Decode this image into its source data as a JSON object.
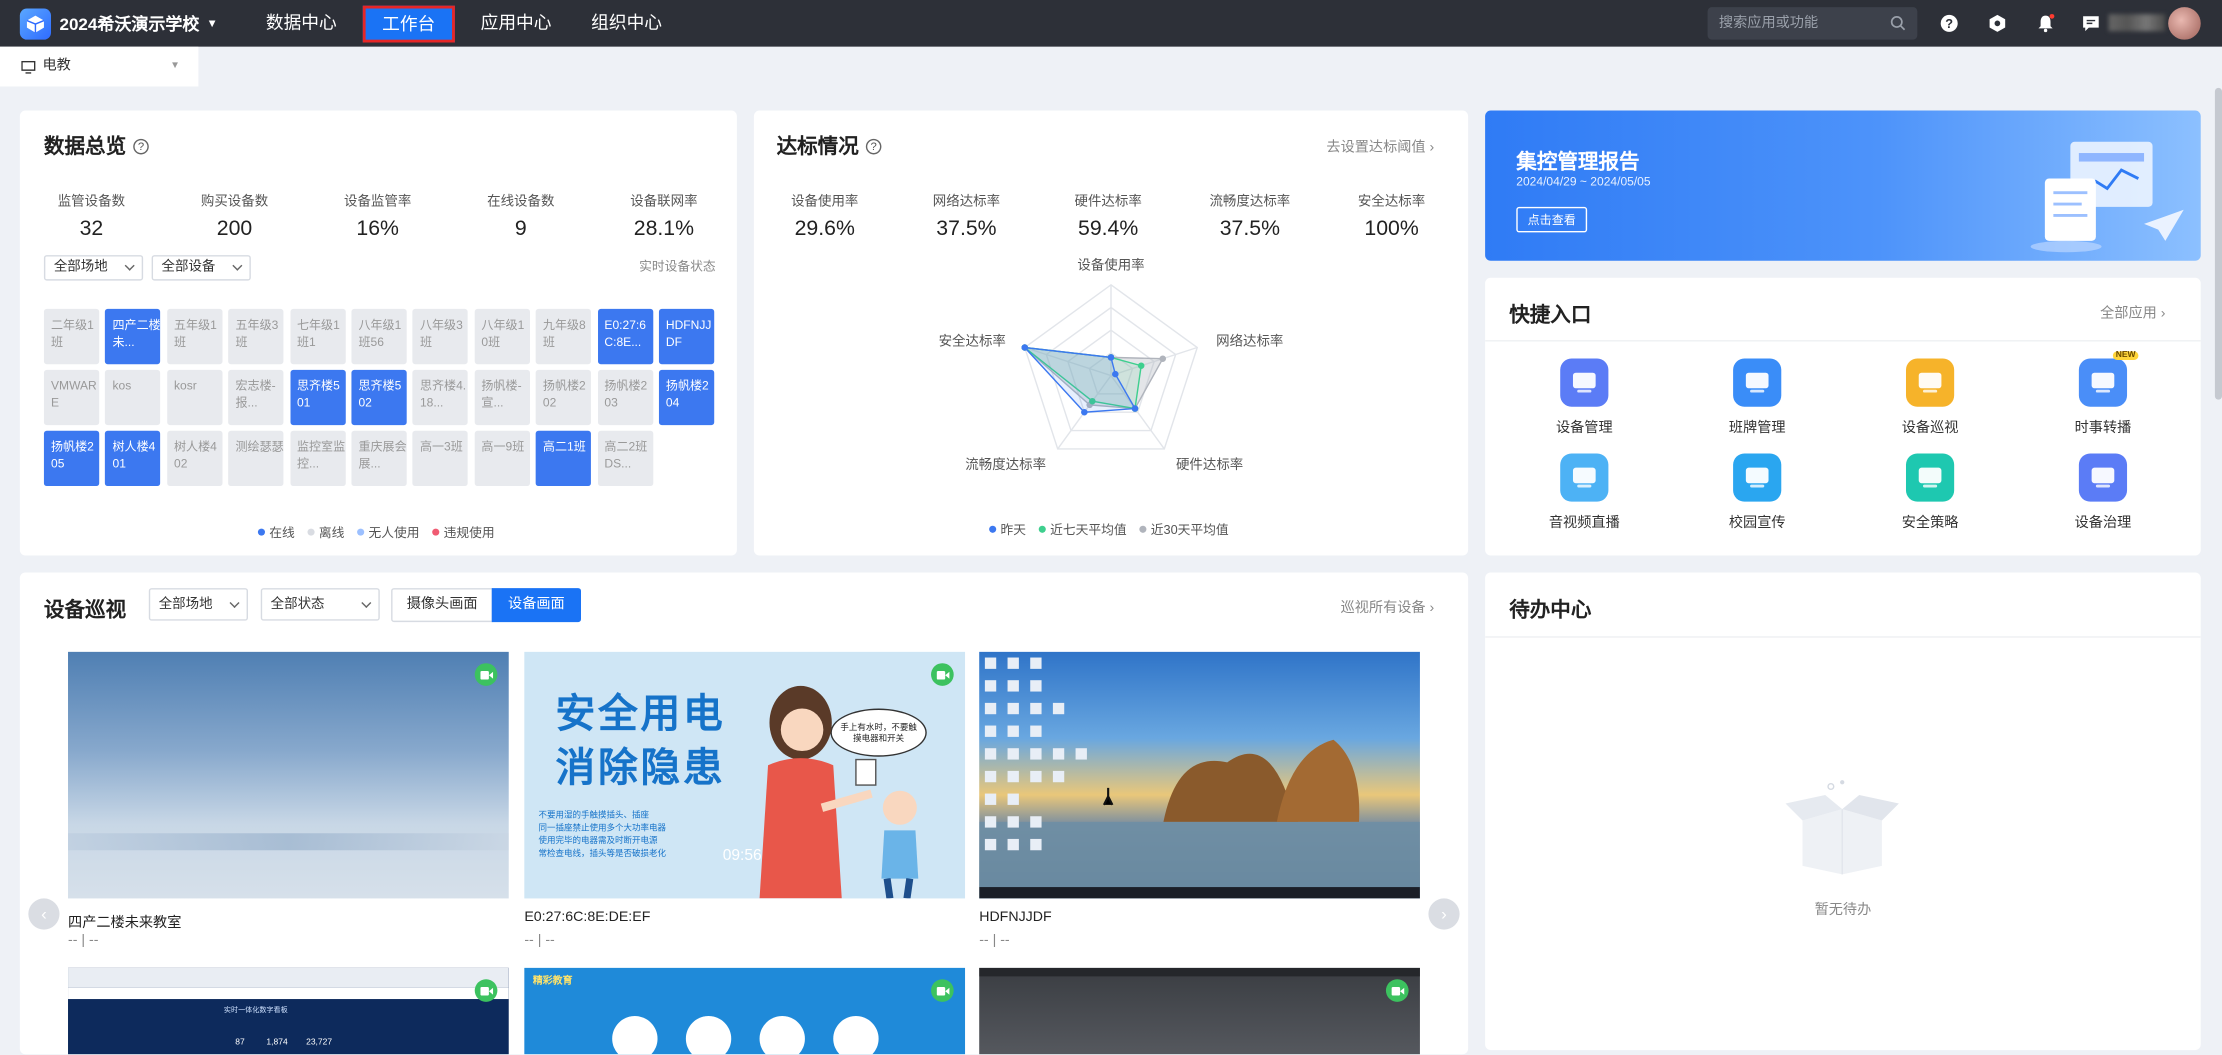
{
  "header": {
    "school": "2024希沃演示学校",
    "nav": [
      "数据中心",
      "工作台",
      "应用中心",
      "组织中心"
    ],
    "active_nav": "工作台",
    "search_placeholder": "搜索应用或功能"
  },
  "subtab": {
    "label": "电教"
  },
  "overview": {
    "title": "数据总览",
    "stats": [
      {
        "label": "监管设备数",
        "value": "32"
      },
      {
        "label": "购买设备数",
        "value": "200"
      },
      {
        "label": "设备监管率",
        "value": "16%"
      },
      {
        "label": "在线设备数",
        "value": "9"
      },
      {
        "label": "设备联网率",
        "value": "28.1%"
      }
    ],
    "filter_site": "全部场地",
    "filter_device": "全部设备",
    "realtime_link": "实时设备状态",
    "cells": [
      {
        "t": "二年级1班",
        "on": false
      },
      {
        "t": "四产二楼未...",
        "on": true
      },
      {
        "t": "五年级1班",
        "on": false
      },
      {
        "t": "五年级3班",
        "on": false
      },
      {
        "t": "七年级1班1",
        "on": false
      },
      {
        "t": "八年级1班56",
        "on": false
      },
      {
        "t": "八年级3班",
        "on": false
      },
      {
        "t": "八年级10班",
        "on": false
      },
      {
        "t": "九年级8班",
        "on": false
      },
      {
        "t": "E0:27:6C:8E...",
        "on": true
      },
      {
        "t": "HDFNJJDF",
        "on": true
      },
      {
        "t": "VMWARE",
        "on": false
      },
      {
        "t": "kos",
        "on": false
      },
      {
        "t": "kosr",
        "on": false
      },
      {
        "t": "宏志楼-报...",
        "on": false
      },
      {
        "t": "思齐楼501",
        "on": true
      },
      {
        "t": "思齐楼502",
        "on": true
      },
      {
        "t": "思齐楼4.18...",
        "on": false
      },
      {
        "t": "扬帆楼-宣...",
        "on": false
      },
      {
        "t": "扬帆楼202",
        "on": false
      },
      {
        "t": "扬帆楼203",
        "on": false
      },
      {
        "t": "扬帆楼204",
        "on": true
      },
      {
        "t": "扬帆楼205",
        "on": true
      },
      {
        "t": "树人楼401",
        "on": true
      },
      {
        "t": "树人楼402",
        "on": false
      },
      {
        "t": "测绘瑟瑟",
        "on": false
      },
      {
        "t": "监控室监控...",
        "on": false
      },
      {
        "t": "重庆展会展...",
        "on": false
      },
      {
        "t": "高一3班",
        "on": false
      },
      {
        "t": "高一9班",
        "on": false
      },
      {
        "t": "高二1班",
        "on": true
      },
      {
        "t": "高二2班DS...",
        "on": false
      }
    ],
    "legend": [
      {
        "label": "在线",
        "color": "#3c78f0"
      },
      {
        "label": "离线",
        "color": "#d9dce2"
      },
      {
        "label": "无人使用",
        "color": "#9cc0ff"
      },
      {
        "label": "违规使用",
        "color": "#f05b72"
      }
    ]
  },
  "compliance": {
    "title": "达标情况",
    "link": "去设置达标阈值",
    "stats": [
      {
        "label": "设备使用率",
        "value": "29.6%"
      },
      {
        "label": "网络达标率",
        "value": "37.5%"
      },
      {
        "label": "硬件达标率",
        "value": "59.4%"
      },
      {
        "label": "流畅度达标率",
        "value": "37.5%"
      },
      {
        "label": "安全达标率",
        "value": "100%"
      }
    ],
    "radar_axes": [
      "设备使用率",
      "网络达标率",
      "硬件达标率",
      "流畅度达标率",
      "安全达标率"
    ],
    "series": [
      {
        "name": "昨天",
        "color": "#3c78f0",
        "values": [
          0.2,
          0.05,
          0.45,
          0.5,
          1.0
        ]
      },
      {
        "name": "近七天平均值",
        "color": "#3ecf8e",
        "values": [
          0.2,
          0.35,
          0.45,
          0.35,
          1.0
        ]
      },
      {
        "name": "近30天平均值",
        "color": "#b0b4bc",
        "values": [
          0.2,
          0.6,
          0.45,
          0.4,
          1.0
        ]
      }
    ]
  },
  "report": {
    "title": "集控管理报告",
    "date": "2024/04/29 ~ 2024/05/05",
    "button": "点击查看"
  },
  "quick": {
    "title": "快捷入口",
    "link": "全部应用",
    "new_badge": "NEW",
    "items": [
      {
        "label": "设备管理",
        "color": "#5b7cf6"
      },
      {
        "label": "班牌管理",
        "color": "#3a8df8"
      },
      {
        "label": "设备巡视",
        "color": "#f6b32a"
      },
      {
        "label": "时事转播",
        "color": "#4a8ef8"
      },
      {
        "label": "音视频直播",
        "color": "#4db2f5"
      },
      {
        "label": "校园宣传",
        "color": "#2aa6f0"
      },
      {
        "label": "安全策略",
        "color": "#1ec8b0"
      },
      {
        "label": "设备治理",
        "color": "#5b7cf6"
      }
    ]
  },
  "patrol": {
    "title": "设备巡视",
    "filter_site": "全部场地",
    "filter_status": "全部状态",
    "seg_camera": "摄像头画面",
    "seg_device": "设备画面",
    "link": "巡视所有设备",
    "tiles": [
      {
        "name": "四产二楼未来教室",
        "sub": "-- | --"
      },
      {
        "name": "E0:27:6C:8E:DE:EF",
        "sub": "-- | --",
        "poster_title_1": "安全用电",
        "poster_title_2": "消除隐患",
        "bubble": "手上有水时，不要触摸电器和开关",
        "time": "09:56",
        "tips": [
          "不要用湿的手触摸插头、插座",
          "同一插座禁止使用多个大功率电器",
          "使用完毕的电器需及时断开电源",
          "常检查电线，插头等是否破损老化"
        ]
      },
      {
        "name": "HDFNJJDF",
        "sub": "-- | --"
      }
    ],
    "bottom_tiles": [
      {
        "banner": "实时一体化数字看板",
        "stats": [
          "87",
          "1,874",
          "23,727"
        ]
      },
      {
        "brand": "精彩教育"
      },
      {}
    ]
  },
  "todo": {
    "title": "待办中心",
    "empty": "暂无待办"
  }
}
